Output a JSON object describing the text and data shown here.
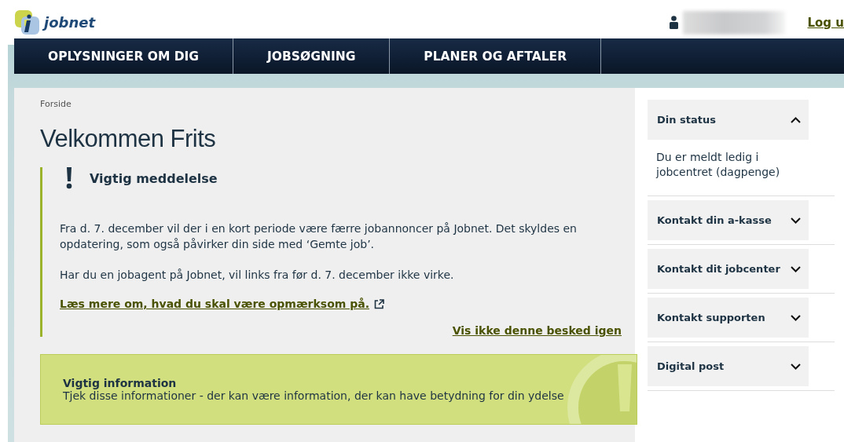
{
  "header": {
    "logo_text": "jobnet",
    "logout": "Log u"
  },
  "nav": [
    {
      "label": "OPLYSNINGER OM DIG",
      "selected": false
    },
    {
      "label": "JOBSØGNING",
      "selected": false
    },
    {
      "label": "PLANER OG AFTALER",
      "selected": false
    }
  ],
  "breadcrumb": "Forside",
  "title": "Velkommen Frits",
  "notice": {
    "title": "Vigtig meddelelse",
    "paragraphs": [
      "Fra d. 7. december vil der i en kort periode være færre jobannoncer på Jobnet. Det skyldes en opdatering, som også påvirker din side med ‘Gemte job’.",
      "Har du en jobagent på Jobnet, vil links fra før d. 7. december ikke virke."
    ],
    "link": "Læs mere om, hvad du skal være opmærksom på.",
    "dismiss": "Vis ikke denne besked igen"
  },
  "info": {
    "title": "Vigtig information",
    "text": "Tjek disse informationer - der kan være information, der kan have betydning for din ydelse"
  },
  "sidebar": [
    {
      "title": "Din status",
      "expanded": true,
      "body": "Du er meldt ledig i jobcentret (dagpenge)"
    },
    {
      "title": "Kontakt din a-kasse",
      "expanded": false
    },
    {
      "title": "Kontakt dit jobcenter",
      "expanded": false
    },
    {
      "title": "Kontakt supporten",
      "expanded": false
    },
    {
      "title": "Digital post",
      "expanded": false
    }
  ]
}
